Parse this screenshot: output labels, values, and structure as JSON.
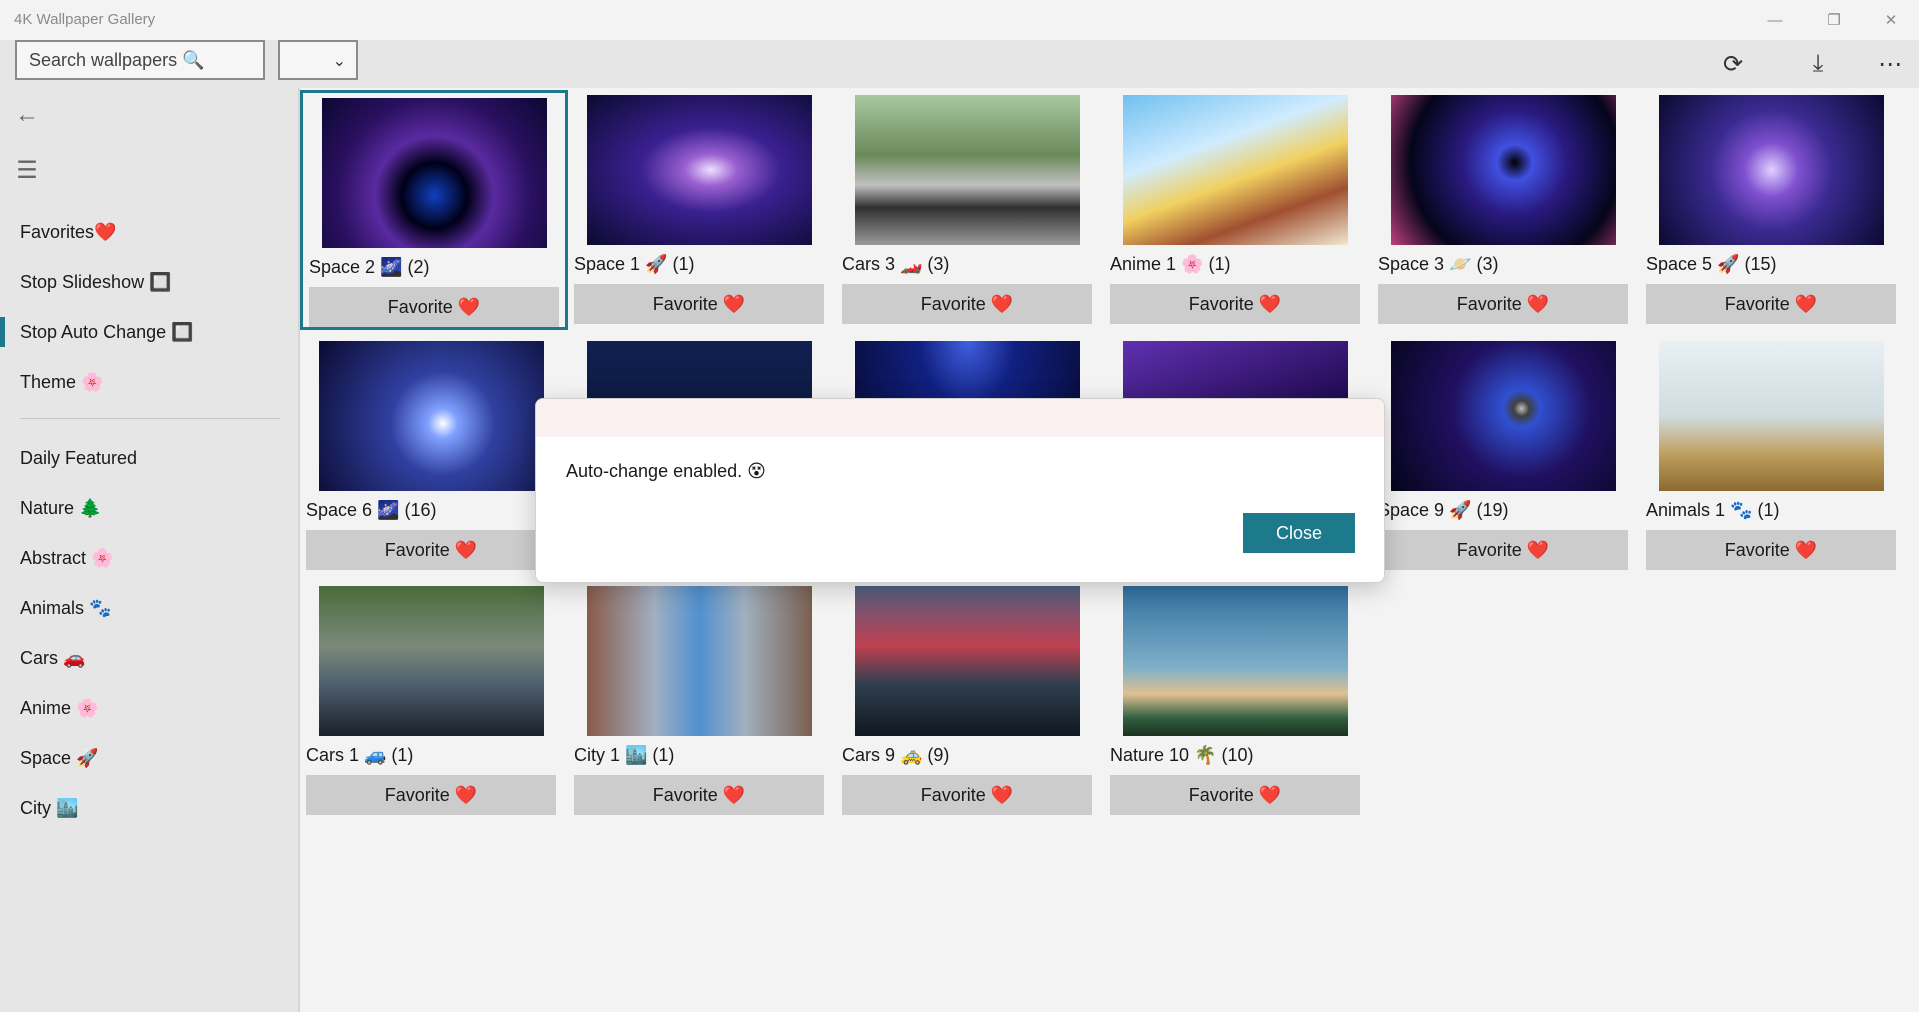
{
  "app": {
    "title": "4K Wallpaper Gallery"
  },
  "window": {
    "minimize_icon": "minimize-icon",
    "restore_icon": "restore-icon",
    "close_icon": "close-icon"
  },
  "toolbar": {
    "search_placeholder": "Search wallpapers 🔍",
    "select_value": "",
    "refresh_icon": "refresh-icon",
    "download_icon": "download-icon",
    "more_icon": "more-icon"
  },
  "sidebar": {
    "back_icon": "back-arrow-icon",
    "menu_icon": "hamburger-icon",
    "items": [
      {
        "label": "Favorites❤️"
      },
      {
        "label": "Stop Slideshow 🔲"
      },
      {
        "label": "Stop Auto Change 🔲"
      },
      {
        "label": "Theme 🌸"
      },
      {
        "label": "Daily Featured"
      },
      {
        "label": "Nature 🌲"
      },
      {
        "label": "Abstract 🌸"
      },
      {
        "label": "Animals 🐾"
      },
      {
        "label": "Cars 🚗"
      },
      {
        "label": "Anime 🌸"
      },
      {
        "label": "Space 🚀"
      },
      {
        "label": "City 🏙️"
      }
    ]
  },
  "gallery": {
    "favorite_label": "Favorite ❤️",
    "tiles": [
      {
        "label": "Space 2 🌌 (2)"
      },
      {
        "label": "Space 1 🚀 (1)"
      },
      {
        "label": "Cars 3 🏎️ (3)"
      },
      {
        "label": "Anime 1 🌸 (1)"
      },
      {
        "label": "Space 3 🪐 (3)"
      },
      {
        "label": "Space 5 🚀 (15)"
      },
      {
        "label": "Space 6 🌌 (16)"
      },
      {
        "label": ""
      },
      {
        "label": ""
      },
      {
        "label": ""
      },
      {
        "label": "Space 9 🚀 (19)"
      },
      {
        "label": "Animals 1 🐾 (1)"
      },
      {
        "label": "Cars 1 🚙 (1)"
      },
      {
        "label": "City 1 🏙️ (1)"
      },
      {
        "label": "Cars 9 🚕 (9)"
      },
      {
        "label": "Nature 10 🌴 (10)"
      }
    ]
  },
  "dialog": {
    "message": "Auto-change enabled. 😵",
    "close_label": "Close"
  },
  "colors": {
    "accent": "#1c7a8c",
    "button_gray": "#cccccc",
    "sidebar_bg": "#e6e6e6"
  }
}
